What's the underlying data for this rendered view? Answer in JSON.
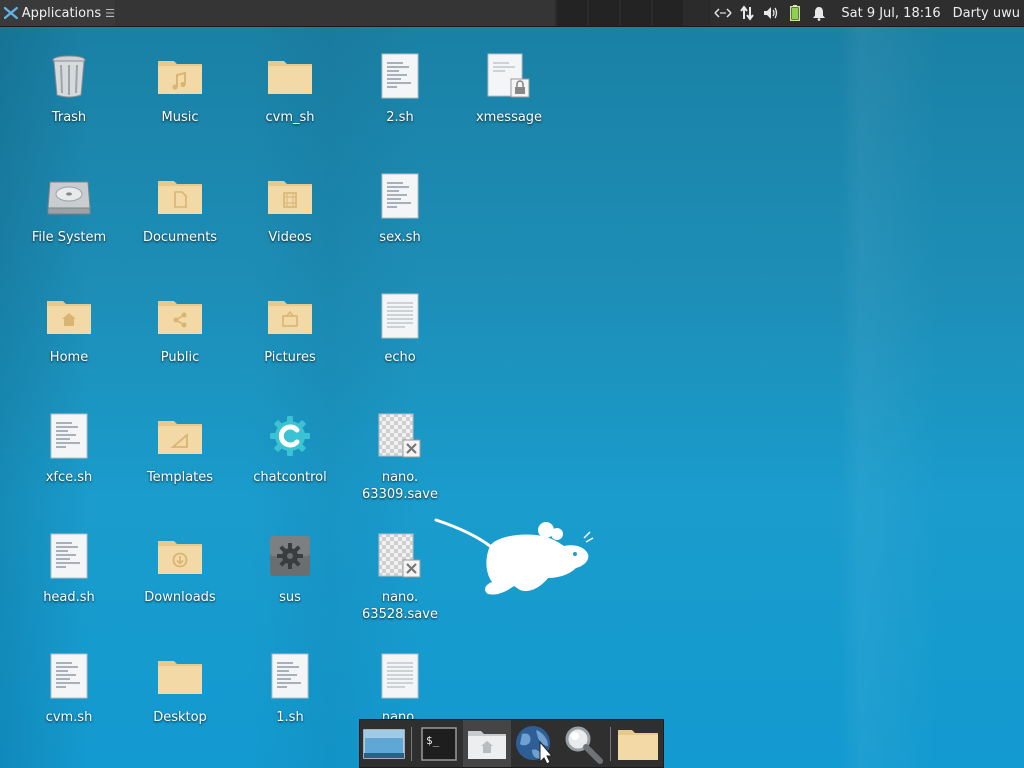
{
  "panel": {
    "applications_label": "Applications",
    "menu_glyph": "☰",
    "tray_icons": [
      "network-arrows-icon",
      "transfer-icon",
      "volume-icon",
      "battery-icon",
      "notification-bell-icon"
    ],
    "clock": "Sat  9 Jul, 18:16",
    "user": "Darty uwu"
  },
  "desktop": {
    "icons": [
      {
        "label": "Trash",
        "icon": "trash-icon"
      },
      {
        "label": "Music",
        "icon": "music-folder-icon"
      },
      {
        "label": "cvm_sh",
        "icon": "folder-icon"
      },
      {
        "label": "2.sh",
        "icon": "script-file-icon"
      },
      {
        "label": "xmessage",
        "icon": "locked-file-icon"
      },
      {
        "label": "File System",
        "icon": "hard-drive-icon"
      },
      {
        "label": "Documents",
        "icon": "documents-folder-icon"
      },
      {
        "label": "Videos",
        "icon": "videos-folder-icon"
      },
      {
        "label": "sex.sh",
        "icon": "script-file-icon"
      },
      {
        "label": "Home",
        "icon": "home-folder-icon"
      },
      {
        "label": "Public",
        "icon": "public-folder-icon"
      },
      {
        "label": "Pictures",
        "icon": "pictures-folder-icon"
      },
      {
        "label": "echo",
        "icon": "text-file-icon"
      },
      {
        "label": "xfce.sh",
        "icon": "script-file-icon"
      },
      {
        "label": "Templates",
        "icon": "templates-folder-icon"
      },
      {
        "label": "chatcontrol",
        "icon": "chatcontrol-gear-icon"
      },
      {
        "label": "nano.\n63309.save",
        "icon": "broken-file-icon"
      },
      {
        "label": "head.sh",
        "icon": "script-file-icon"
      },
      {
        "label": "Downloads",
        "icon": "downloads-folder-icon"
      },
      {
        "label": "sus",
        "icon": "settings-executable-icon"
      },
      {
        "label": "nano.\n63528.save",
        "icon": "broken-file-icon"
      },
      {
        "label": "cvm.sh",
        "icon": "script-file-icon"
      },
      {
        "label": "Desktop",
        "icon": "folder-icon"
      },
      {
        "label": "1.sh",
        "icon": "script-file-icon"
      },
      {
        "label": "nano.",
        "icon": "text-file-icon"
      }
    ]
  },
  "dock": {
    "items": [
      "show-desktop-icon",
      "terminal-icon",
      "home-folder-icon",
      "web-browser-icon",
      "search-magnifier-icon",
      "file-manager-folder-icon"
    ],
    "terminal_glyph": "$_"
  },
  "colors": {
    "panel_bg": "#2b2b2b",
    "folder_fill": "#f3d9a6",
    "folder_tab": "#e8c98c",
    "desktop_bg": "#1a8fbb"
  }
}
